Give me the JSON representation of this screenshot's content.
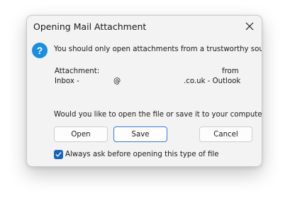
{
  "dialog": {
    "title": "Opening Mail Attachment",
    "message": "You should only open attachments from a trustworthy source.",
    "attachment_label": "Attachment:",
    "attachment_from": "from",
    "attachment_inbox": "Inbox -",
    "attachment_at": "@",
    "attachment_domain": ".co.uk - Outlook",
    "question": "Would you like to open the file or save it to your computer?",
    "buttons": {
      "open": "Open",
      "save": "Save",
      "cancel": "Cancel"
    },
    "checkbox": {
      "label": "Always ask before opening this type of file",
      "checked": true
    },
    "icon": "question-icon",
    "colors": {
      "accent": "#1565c0",
      "info_icon": "#1a8ee0",
      "dialog_bg": "#f3f3f3"
    }
  }
}
